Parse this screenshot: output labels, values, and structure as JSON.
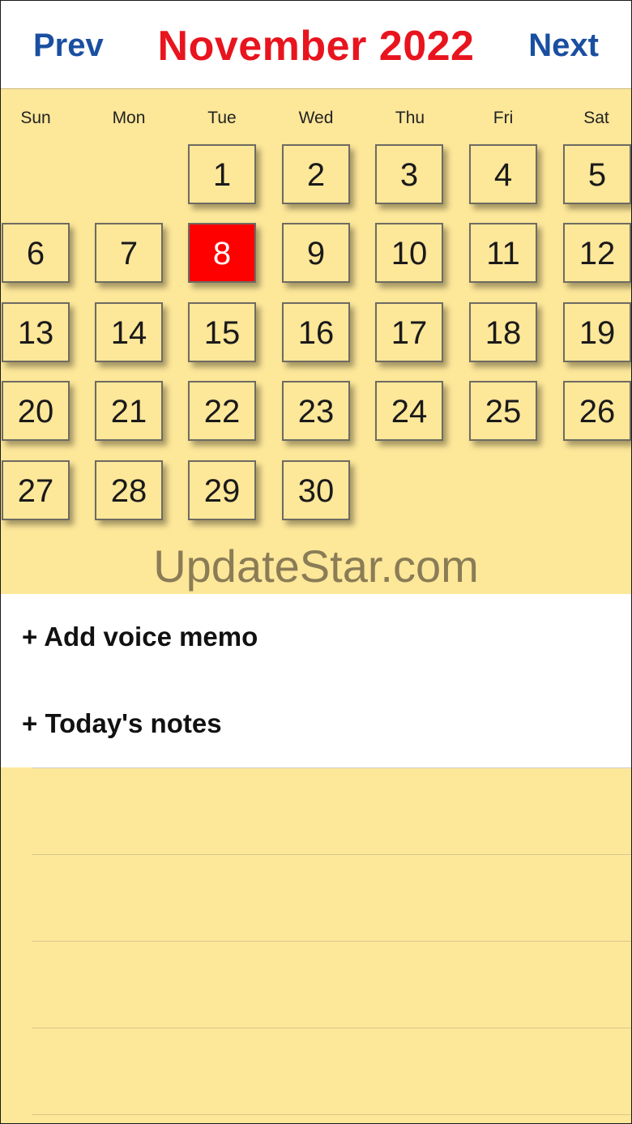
{
  "header": {
    "prev_label": "Prev",
    "next_label": "Next",
    "month_title": "November  2022",
    "colors": {
      "nav": "#1a4fa0",
      "title": "#e8141e"
    }
  },
  "weekdays": [
    "Sun",
    "Mon",
    "Tue",
    "Wed",
    "Thu",
    "Fri",
    "Sat"
  ],
  "calendar": {
    "weeks": [
      [
        "",
        "",
        "1",
        "2",
        "3",
        "4",
        "5"
      ],
      [
        "6",
        "7",
        "8",
        "9",
        "10",
        "11",
        "12"
      ],
      [
        "13",
        "14",
        "15",
        "16",
        "17",
        "18",
        "19"
      ],
      [
        "20",
        "21",
        "22",
        "23",
        "24",
        "25",
        "26"
      ],
      [
        "27",
        "28",
        "29",
        "30",
        "",
        "",
        ""
      ]
    ],
    "selected_day": "8",
    "colors": {
      "day_bg": "#fde799",
      "selected_bg": "#ff0000"
    }
  },
  "watermark": "UpdateStar.com",
  "actions": {
    "add_voice_memo": "+ Add voice memo",
    "todays_notes": "+ Today's notes"
  }
}
